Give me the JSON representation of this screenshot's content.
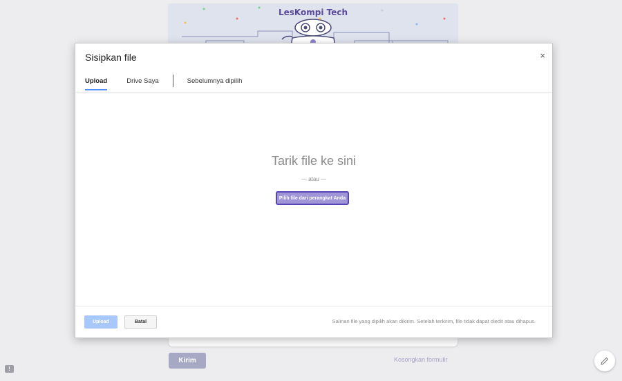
{
  "background_form": {
    "banner_title": "LesKompi Tech",
    "submit_label": "Kirim",
    "clear_label": "Kosongkan formulir",
    "feedback_icon_glyph": "!"
  },
  "dialog": {
    "title": "Sisipkan file",
    "close_glyph": "×",
    "tabs": [
      {
        "label": "Upload",
        "active": true
      },
      {
        "label": "Drive Saya",
        "active": false
      },
      {
        "label": "Sebelumnya dipilih",
        "active": false
      }
    ],
    "drop_title": "Tarik file ke sini",
    "drop_or": "— atau —",
    "pick_button": "Pilih file dari perangkat Anda",
    "upload_button": "Upload",
    "cancel_button": "Batal",
    "footer_note": "Salinan file yang dipilih akan dikirim. Setelah terkirim, file tidak dapat diedit atau dihapus."
  },
  "colors": {
    "accent": "#4d90fe",
    "pick_button_fill": "#a095d6",
    "pick_button_border": "#5646b8",
    "banner_text": "#5b4a9a"
  },
  "icons": {
    "close": "close-icon",
    "edit": "pencil-icon",
    "feedback": "feedback-icon"
  }
}
